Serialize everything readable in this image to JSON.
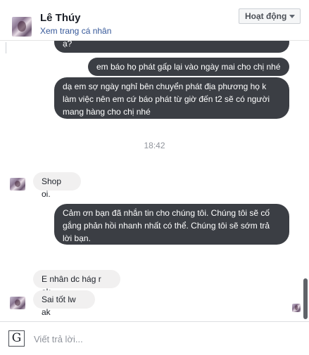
{
  "header": {
    "name": "Lê Thúy",
    "profile_link": "Xem trang cá nhân",
    "status": "Hoạt động"
  },
  "messages": [
    {
      "side": "out",
      "lines": [
        "ạ?"
      ]
    },
    {
      "side": "out",
      "lines": [
        "em báo họ phát gấp lại vào ngày mai cho chị nhé"
      ]
    },
    {
      "side": "out",
      "lines": [
        "dạ em sợ ngày nghỉ bên chuyển phát địa phương họ k",
        "làm việc nên em cứ báo phát từ giờ đến t2 sẽ có người",
        "mang hàng cho chị nhé"
      ]
    },
    {
      "side": "time",
      "lines": [
        "18:42"
      ]
    },
    {
      "side": "in",
      "lines": [
        "Shop oi."
      ]
    },
    {
      "side": "out",
      "lines": [
        "Cảm ơn bạn đã nhắn tin cho chúng tôi. Chúng tôi sẽ cố",
        "gắng phản hồi nhanh nhất có thể. Chúng tôi sẽ sớm trả",
        "lời bạn."
      ]
    },
    {
      "side": "in",
      "lines": [
        "E nhân dc hág r ak"
      ]
    },
    {
      "side": "in",
      "lines": [
        "Sai tốt lw ak"
      ]
    }
  ],
  "composer": {
    "icon": "G",
    "placeholder": "Viết trả lời..."
  },
  "colors": {
    "outgoing_bubble": "#3b3e44",
    "incoming_bubble": "#f1f0f0",
    "link": "#365899"
  }
}
